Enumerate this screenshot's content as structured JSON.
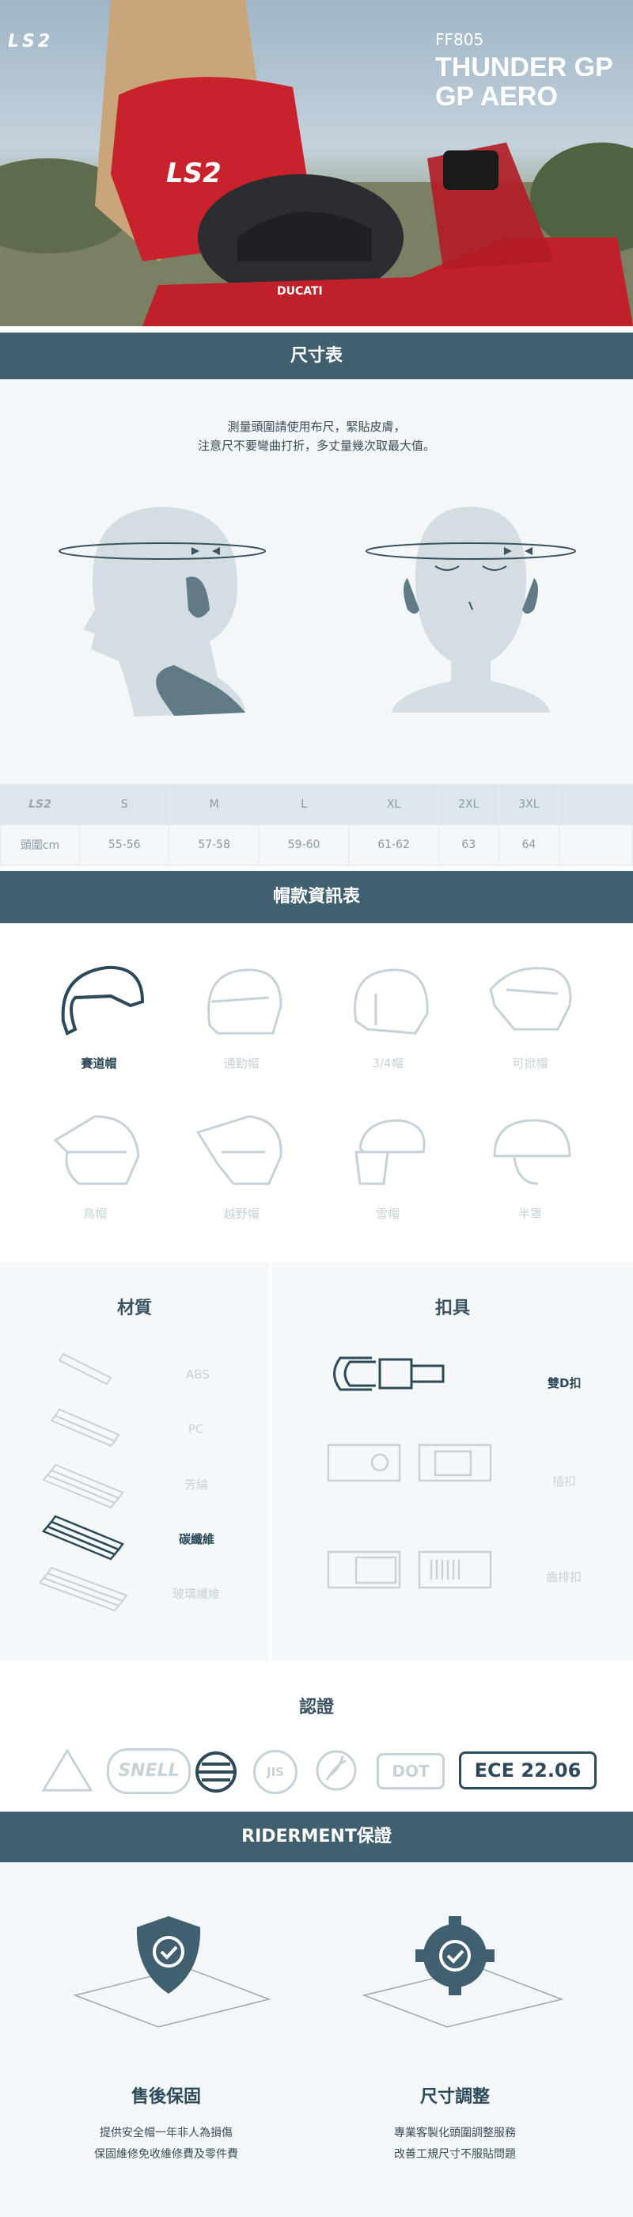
{
  "hero": {
    "brand": "LS2",
    "model": "FF805",
    "title_line1": "THUNDER GP",
    "title_line2": "GP AERO",
    "helmet_brand": "DUCATI"
  },
  "size_chart": {
    "heading": "尺寸表",
    "note_line1": "測量頭圍請使用布尺，緊貼皮膚，",
    "note_line2": "注意尺不要彎曲打折，多丈量幾次取最大值。",
    "row_label": "頭圍cm",
    "sizes": [
      "S",
      "M",
      "L",
      "XL",
      "2XL",
      "3XL"
    ],
    "values": [
      "55-56",
      "57-58",
      "59-60",
      "61-62",
      "63",
      "64"
    ]
  },
  "helmet_types": {
    "heading": "帽款資訊表",
    "items": [
      "賽道帽",
      "通勤帽",
      "3/4帽",
      "可掀帽",
      "鳥帽",
      "越野帽",
      "雪帽",
      "半罩"
    ],
    "active_index": 0
  },
  "material": {
    "heading": "材質",
    "items": [
      "ABS",
      "PC",
      "芳綸",
      "碳纖維",
      "玻璃纖維"
    ],
    "active_index": 3
  },
  "buckle": {
    "heading": "扣具",
    "items": [
      "雙D扣",
      "插扣",
      "齒排扣"
    ],
    "active_index": 0
  },
  "certification": {
    "heading": "認證",
    "items": [
      "SNELL",
      "JIS",
      "DOT",
      "ECE 22.06"
    ],
    "active": "ECE 22.06"
  },
  "guarantee": {
    "heading": "RIDERMENT保證",
    "items": [
      {
        "title": "售後保固",
        "line1": "提供安全帽一年非人為損傷",
        "line2": "保固維修免收維修費及零件費"
      },
      {
        "title": "尺寸調整",
        "line1": "專業客製化頭圍調整服務",
        "line2": "改善工規尺寸不服貼問題"
      }
    ]
  },
  "colors": {
    "accent": "#406070",
    "active": "#2e4a58",
    "inactive": "#c6d2d8"
  }
}
